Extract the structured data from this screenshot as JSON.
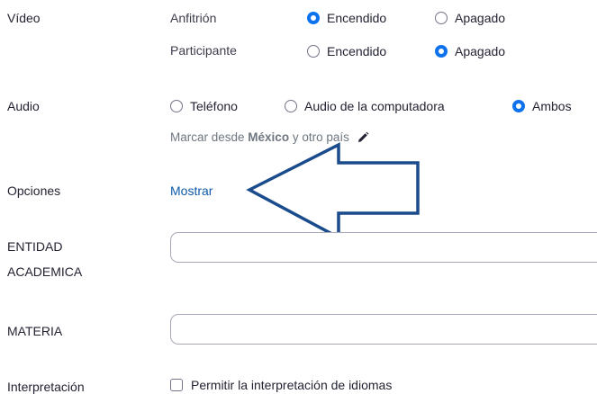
{
  "video": {
    "label": "Vídeo",
    "host": {
      "label": "Anfitrión",
      "on": "Encendido",
      "off": "Apagado",
      "selected": "on"
    },
    "participant": {
      "label": "Participante",
      "on": "Encendido",
      "off": "Apagado",
      "selected": "off"
    }
  },
  "audio": {
    "label": "Audio",
    "options": [
      "Teléfono",
      "Audio de la computadora",
      "Ambos"
    ],
    "selected": "Ambos",
    "dial_prefix": "Marcar desde ",
    "dial_country": "México",
    "dial_suffix": " y otro país"
  },
  "options": {
    "label": "Opciones",
    "show_link": "Mostrar"
  },
  "entidad": {
    "label_line1": "ENTIDAD",
    "label_line2": "ACADEMICA",
    "value": ""
  },
  "materia": {
    "label": "MATERIA",
    "value": ""
  },
  "interpretation": {
    "label": "Interpretación",
    "checkbox_label": "Permitir la interpretación de idiomas"
  },
  "colors": {
    "accent": "#0e72ed",
    "link": "#0e5aa8",
    "arrow": "#1a4b8c"
  },
  "icons": {
    "edit": "pencil-icon",
    "pointer": "left-arrow-annotation"
  }
}
